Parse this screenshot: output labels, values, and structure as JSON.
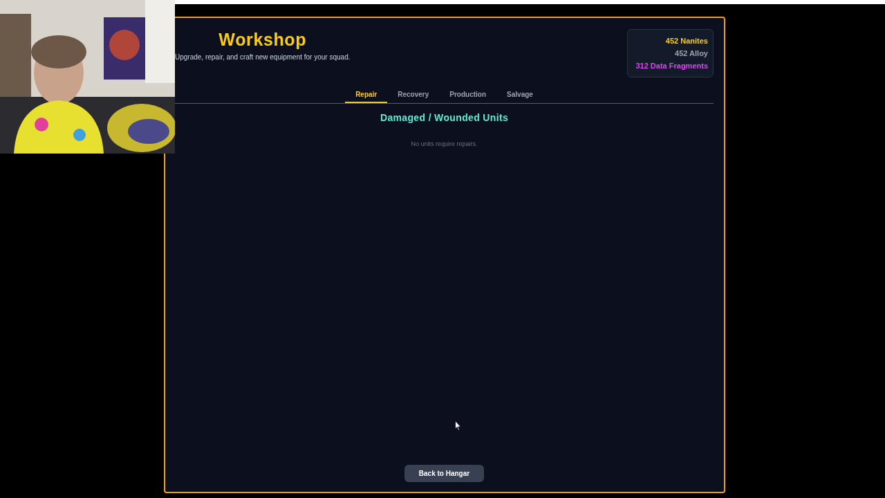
{
  "header": {
    "title": "Workshop",
    "subtitle": "Upgrade, repair, and craft new equipment for your squad."
  },
  "resources": [
    {
      "text": "452 Nanites",
      "color": "#facc15"
    },
    {
      "text": "452 Alloy",
      "color": "#9ca3af"
    },
    {
      "text": "312 Data Fragments",
      "color": "#d946ef"
    }
  ],
  "tabs": [
    {
      "label": "Repair",
      "selected": true
    },
    {
      "label": "Recovery",
      "selected": false
    },
    {
      "label": "Production",
      "selected": false
    },
    {
      "label": "Salvage",
      "selected": false
    }
  ],
  "section_title": "Damaged / Wounded Units",
  "empty_message": "No units require repairs.",
  "back_button": "Back to Hangar"
}
